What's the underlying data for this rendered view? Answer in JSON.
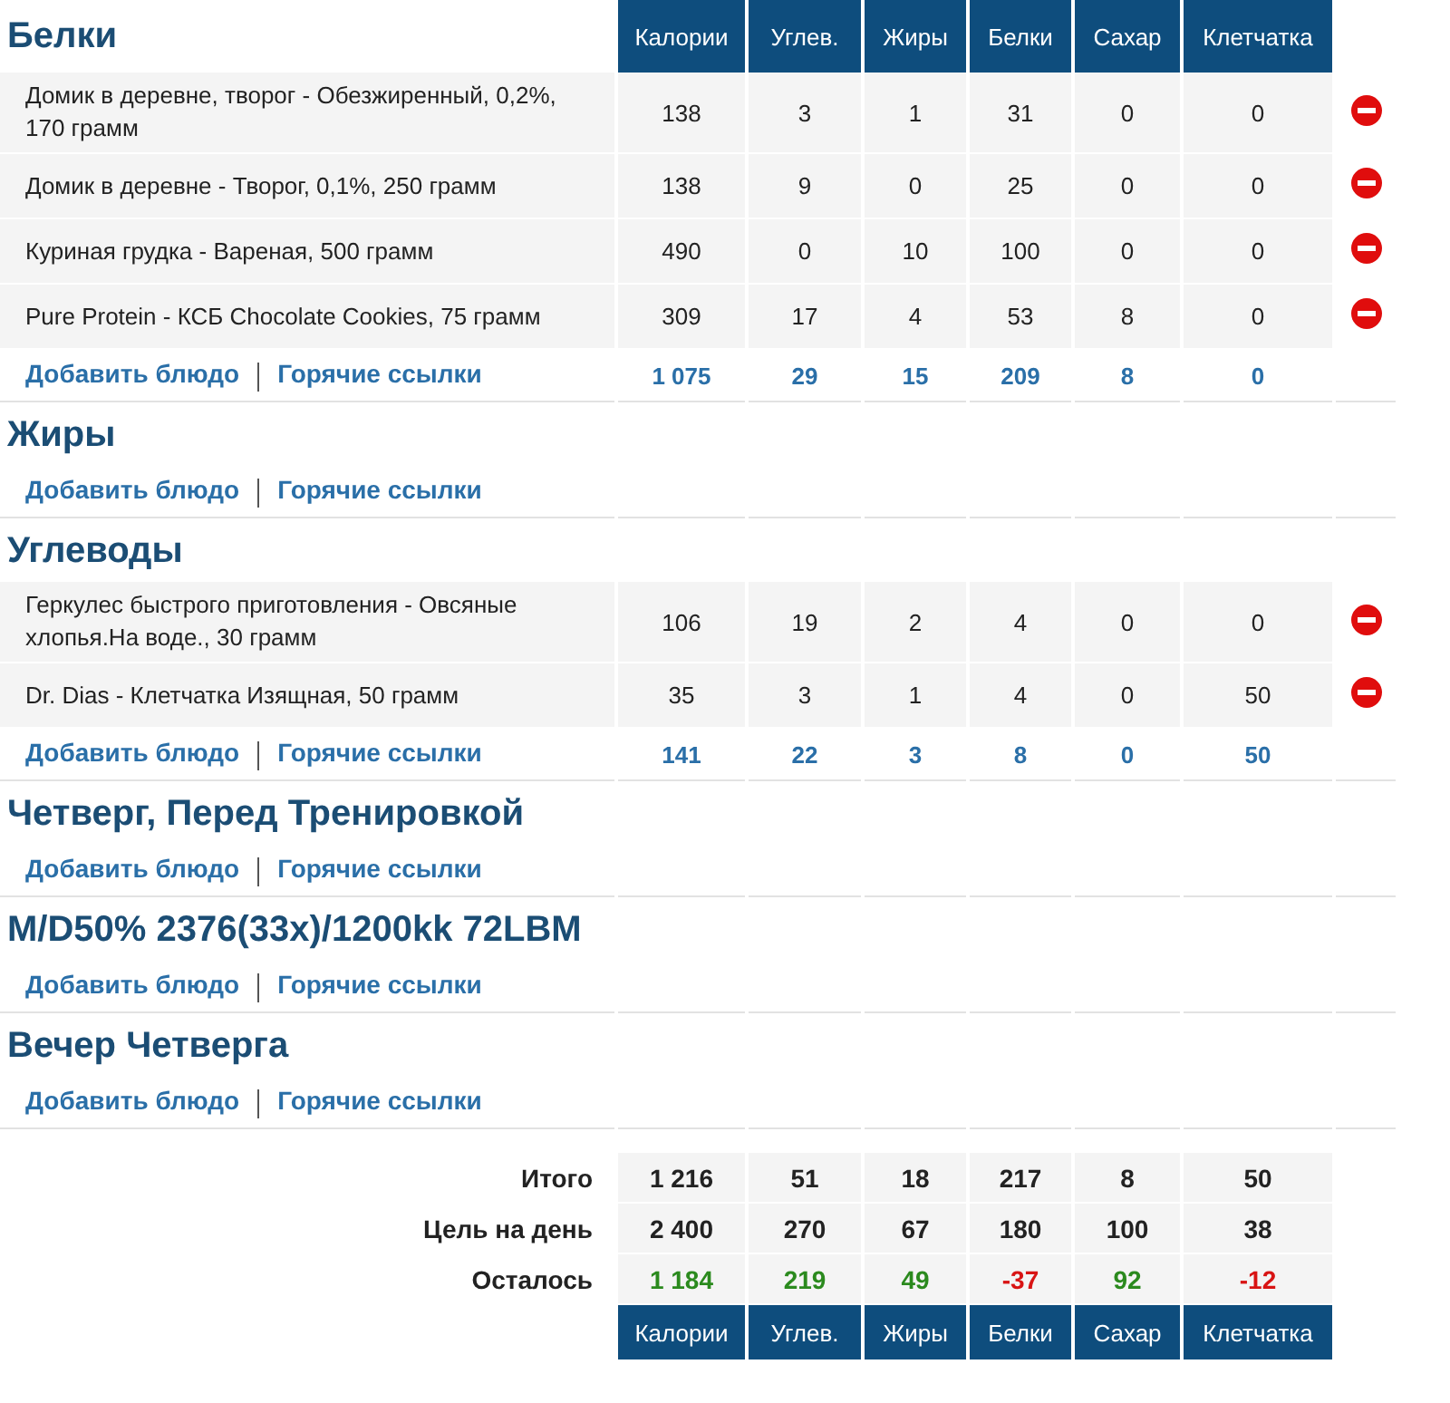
{
  "meals": [
    {
      "title": "Белки",
      "columns": [
        "Калории",
        "Углев.",
        "Жиры",
        "Белки",
        "Сахар",
        "Клетчатка"
      ],
      "foods": [
        {
          "name": "Домик в деревне, творог - Обезжиренный, 0,2%, 170 грамм",
          "values": [
            "138",
            "3",
            "1",
            "31",
            "0",
            "0"
          ]
        },
        {
          "name": "Домик в деревне - Творог, 0,1%, 250 грамм",
          "values": [
            "138",
            "9",
            "0",
            "25",
            "0",
            "0"
          ]
        },
        {
          "name": "Куриная грудка - Вареная, 500 грамм",
          "values": [
            "490",
            "0",
            "10",
            "100",
            "0",
            "0"
          ]
        },
        {
          "name": "Pure Protein - КСБ Chocolate Cookies, 75 грамм",
          "values": [
            "309",
            "17",
            "4",
            "53",
            "8",
            "0"
          ]
        }
      ],
      "add_link": "Добавить блюдо",
      "hot_link": "Горячие ссылки",
      "totals": [
        "1 075",
        "29",
        "15",
        "209",
        "8",
        "0"
      ]
    },
    {
      "title": "Жиры",
      "add_link": "Добавить блюдо",
      "hot_link": "Горячие ссылки"
    },
    {
      "title": "Углеводы",
      "foods": [
        {
          "name": "Геркулес быстрого приготовления - Овсяные хлопья.На воде., 30 грамм",
          "values": [
            "106",
            "19",
            "2",
            "4",
            "0",
            "0"
          ]
        },
        {
          "name": "Dr. Dias - Клетчатка Изящная, 50 грамм",
          "values": [
            "35",
            "3",
            "1",
            "4",
            "0",
            "50"
          ]
        }
      ],
      "add_link": "Добавить блюдо",
      "hot_link": "Горячие ссылки",
      "totals": [
        "141",
        "22",
        "3",
        "8",
        "0",
        "50"
      ]
    },
    {
      "title": "Четверг, Перед Тренировкой",
      "add_link": "Добавить блюдо",
      "hot_link": "Горячие ссылки"
    },
    {
      "title": "M/D50% 2376(33x)/1200kk 72LBM",
      "add_link": "Добавить блюдо",
      "hot_link": "Горячие ссылки"
    },
    {
      "title": "Вечер Четверга",
      "add_link": "Добавить блюдо",
      "hot_link": "Горячие ссылки"
    }
  ],
  "summary": {
    "rows": [
      {
        "label": "Итого",
        "values": [
          "1 216",
          "51",
          "18",
          "217",
          "8",
          "50"
        ]
      },
      {
        "label": "Цель на день",
        "values": [
          "2 400",
          "270",
          "67",
          "180",
          "100",
          "38"
        ]
      }
    ],
    "remaining": {
      "label": "Осталось",
      "values": [
        {
          "value": "1 184",
          "over": false
        },
        {
          "value": "219",
          "over": false
        },
        {
          "value": "49",
          "over": false
        },
        {
          "value": "-37",
          "over": true
        },
        {
          "value": "92",
          "over": false
        },
        {
          "value": "-12",
          "over": true
        }
      ]
    },
    "columns": [
      "Калории",
      "Углев.",
      "Жиры",
      "Белки",
      "Сахар",
      "Клетчатка"
    ]
  }
}
